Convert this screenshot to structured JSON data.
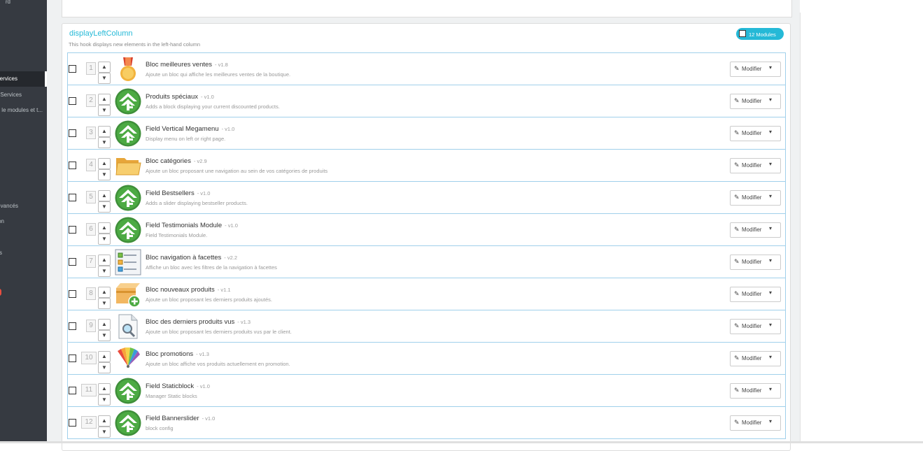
{
  "sidebar": {
    "items": [
      {
        "label": "rd"
      },
      {
        "label": "ervices",
        "active": true
      },
      {
        "label": "Services"
      },
      {
        "label": "le modules et t..."
      },
      {
        "label": "vancés"
      },
      {
        "label": "on"
      },
      {
        "label": "s"
      }
    ]
  },
  "hook": {
    "title": "displayLeftColumn",
    "description": "This hook displays new elements in the left-hand column",
    "module_count": "12 Modules"
  },
  "edit_label": "Modifier",
  "modules": [
    {
      "position": "1",
      "name": "Bloc meilleures ventes",
      "version": "- v1.8",
      "description": "Ajoute un bloc qui affiche les meilleures ventes de la boutique.",
      "icon": "medal-icon"
    },
    {
      "position": "2",
      "name": "Produits spéciaux",
      "version": "- v1.0",
      "description": "Adds a block displaying your current discounted products.",
      "icon": "field-logo-icon"
    },
    {
      "position": "3",
      "name": "Field Vertical Megamenu",
      "version": "- v1.0",
      "description": "Display menu on left or right page.",
      "icon": "field-logo-icon"
    },
    {
      "position": "4",
      "name": "Bloc catégories",
      "version": "- v2.9",
      "description": "Ajoute un bloc proposant une navigation au sein de vos catégories de produits",
      "icon": "folder-icon"
    },
    {
      "position": "5",
      "name": "Field Bestsellers",
      "version": "- v1.0",
      "description": "Adds a slider displaying bestseller products.",
      "icon": "field-logo-icon"
    },
    {
      "position": "6",
      "name": "Field Testimonials Module",
      "version": "- v1.0",
      "description": "Field Testimonials Module.",
      "icon": "field-logo-icon"
    },
    {
      "position": "7",
      "name": "Bloc navigation à facettes",
      "version": "- v2.2",
      "description": "Affiche un bloc avec les filtres de la navigation à facettes",
      "icon": "filter-list-icon"
    },
    {
      "position": "8",
      "name": "Bloc nouveaux produits",
      "version": "- v1.1",
      "description": "Ajoute un bloc proposant les derniers produits ajoutés.",
      "icon": "new-box-icon"
    },
    {
      "position": "9",
      "name": "Bloc des derniers produits vus",
      "version": "- v1.3",
      "description": "Ajoute un bloc proposant les derniers produits vus par le client.",
      "icon": "magnifier-document-icon"
    },
    {
      "position": "10",
      "name": "Bloc promotions",
      "version": "- v1.3",
      "description": "Ajoute un bloc affiche vos produits actuellement en promotion.",
      "icon": "color-swatch-icon"
    },
    {
      "position": "11",
      "name": "Field Staticblock",
      "version": "- v1.0",
      "description": "Manager Static blocks",
      "icon": "field-logo-icon"
    },
    {
      "position": "12",
      "name": "Field Bannerslider",
      "version": "- v1.0",
      "description": "block config",
      "icon": "field-logo-icon"
    }
  ]
}
